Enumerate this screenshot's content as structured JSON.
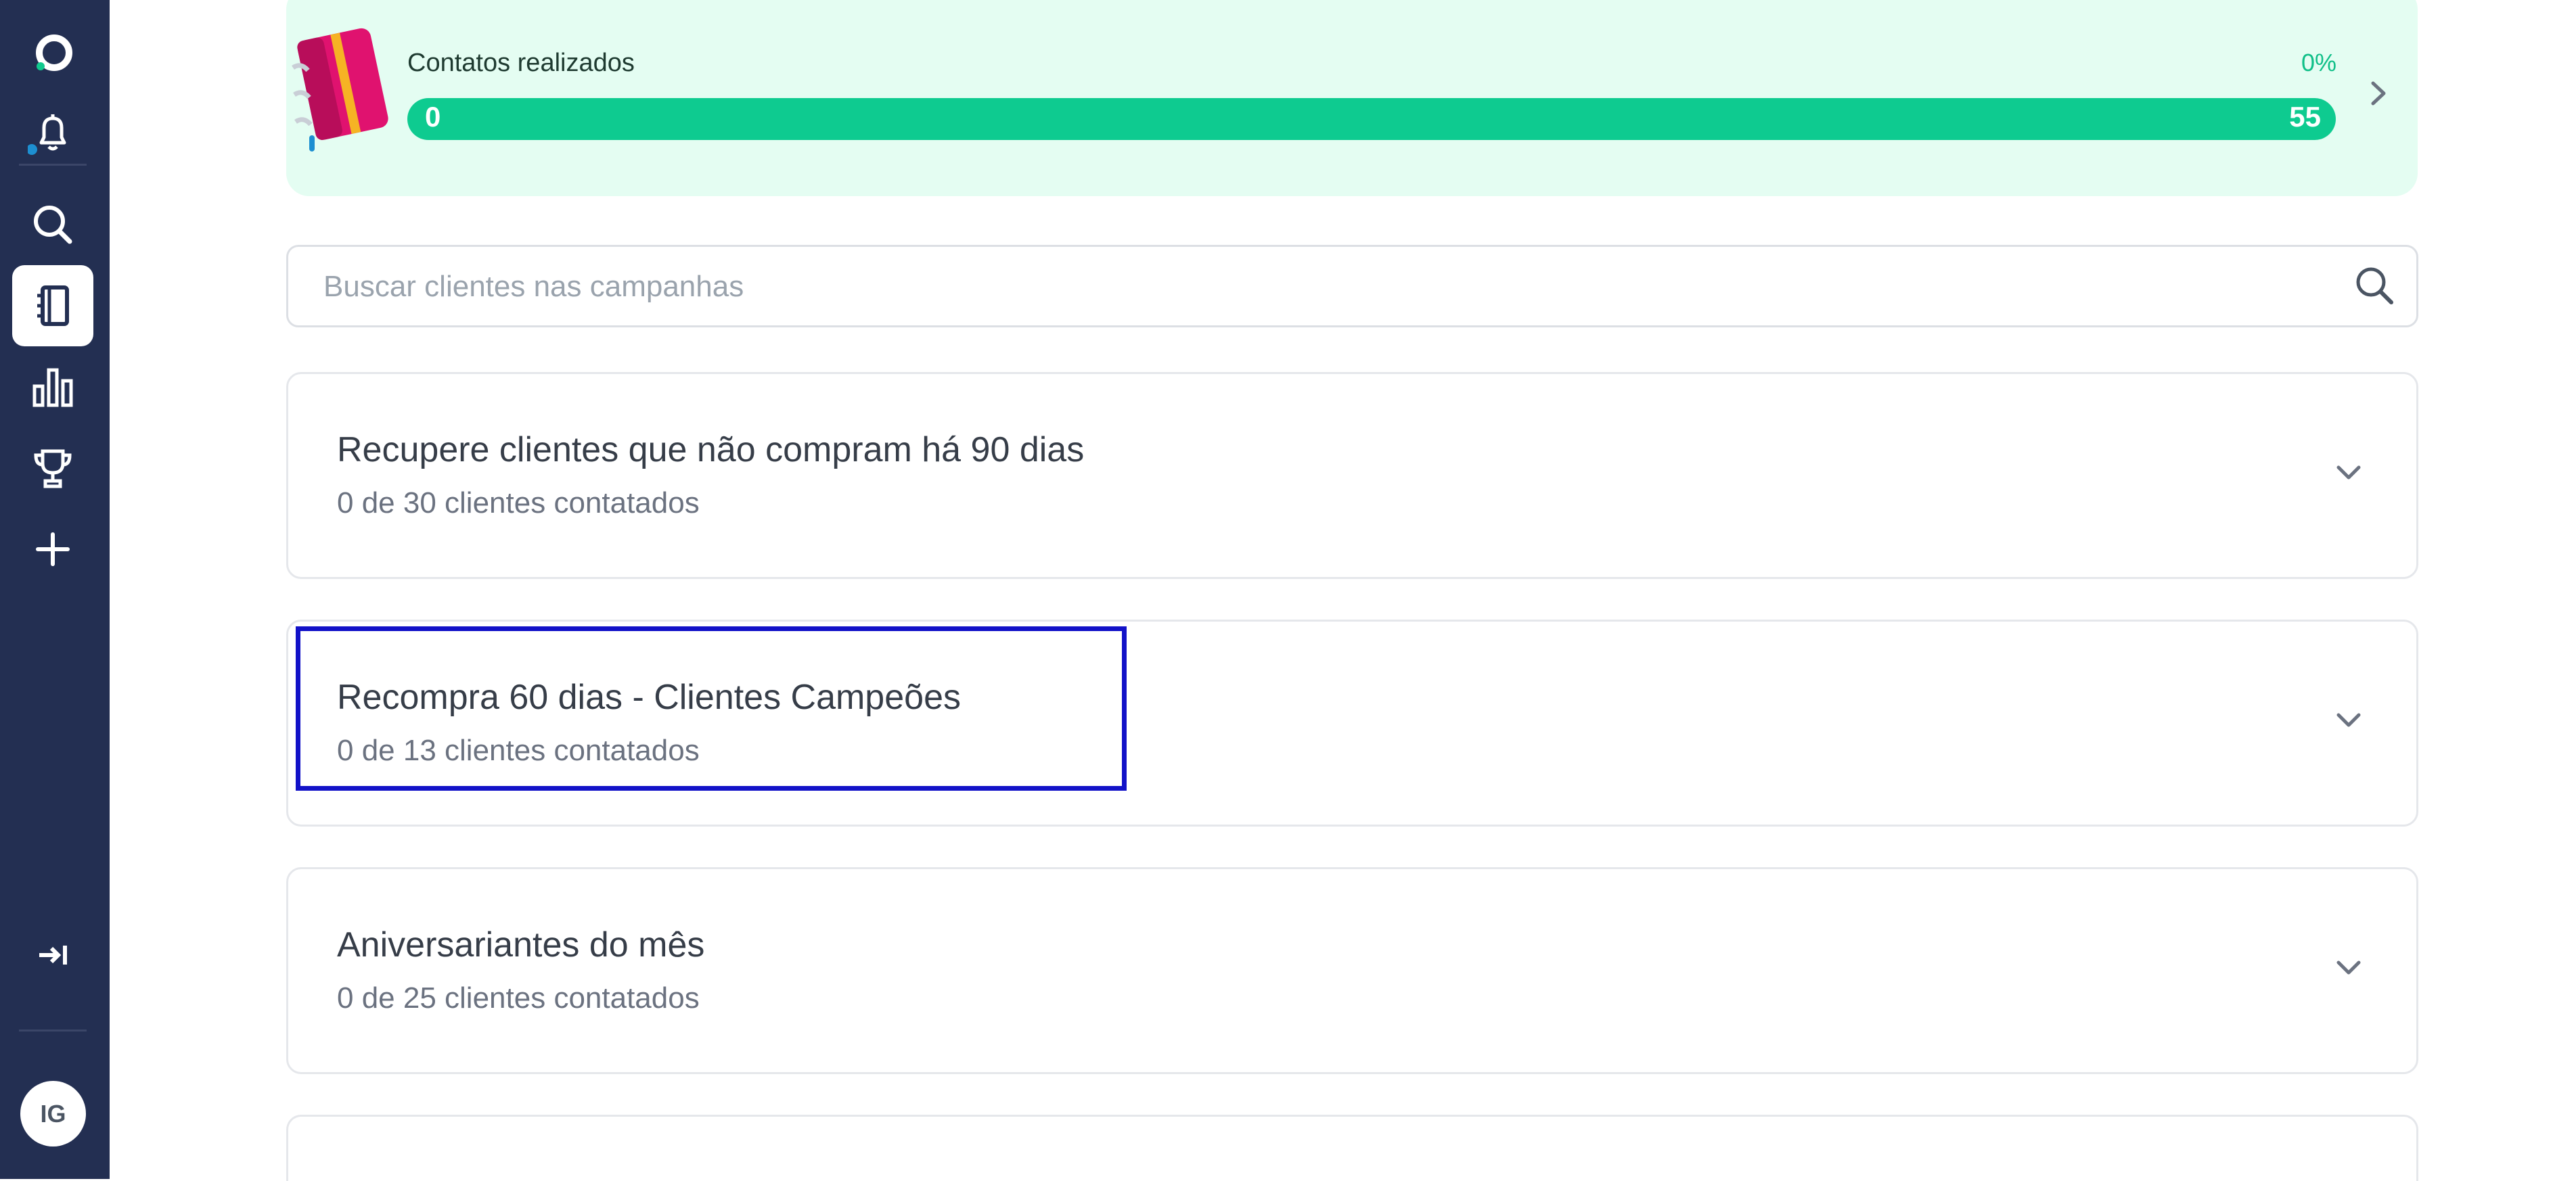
{
  "sidebar": {
    "icons": [
      {
        "name": "logo-icon"
      },
      {
        "name": "notification-bell-icon"
      },
      {
        "name": "search-icon"
      },
      {
        "name": "campaigns-notebook-icon",
        "active": true
      },
      {
        "name": "bar-chart-icon"
      },
      {
        "name": "trophy-icon"
      },
      {
        "name": "plus-icon"
      },
      {
        "name": "collapse-sidebar-icon"
      }
    ],
    "avatar_initials": "IG"
  },
  "progress": {
    "label": "Contatos realizados",
    "percent_label": "0%",
    "min_label": "0",
    "max_label": "55",
    "fraction": 0.0
  },
  "search": {
    "placeholder": "Buscar clientes nas campanhas"
  },
  "campaigns": [
    {
      "title": "Recupere clientes que não compram há 90 dias",
      "subtitle": "0 de 30 clientes contatados"
    },
    {
      "title": "Recompra 60 dias - Clientes Campeões",
      "subtitle": "0 de 13 clientes contatados"
    },
    {
      "title": "Aniversariantes do mês",
      "subtitle": "0 de 25 clientes contatados"
    }
  ],
  "colors": {
    "sidebar_bg": "#232f52",
    "progress_card_bg": "#e4fdf2",
    "progress_bar": "#0ecb90",
    "highlight": "#1212c8"
  }
}
